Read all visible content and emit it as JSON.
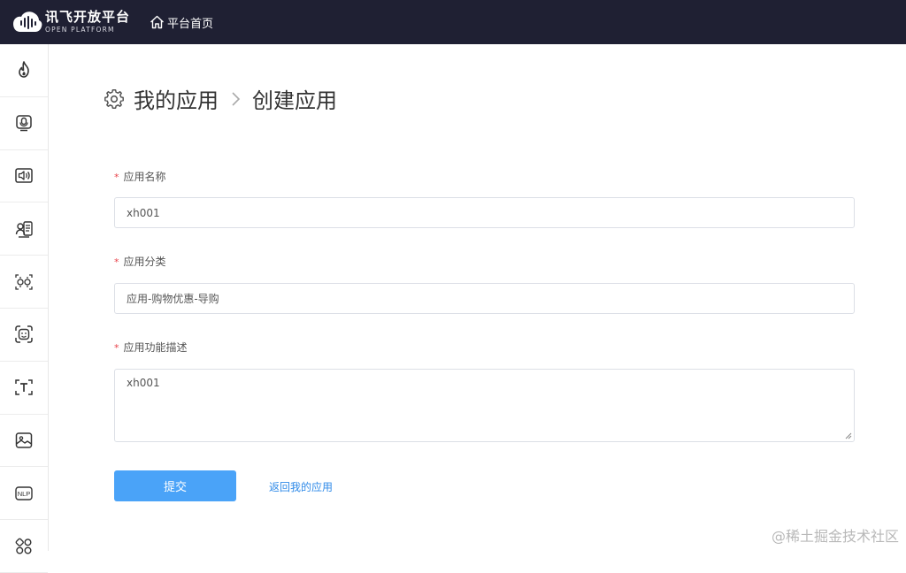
{
  "header": {
    "logo_cn": "讯飞开放平台",
    "logo_en": "OPEN PLATFORM",
    "home_label": "平台首页"
  },
  "sidebar": {
    "items": [
      {
        "icon": "flame-icon"
      },
      {
        "icon": "microphone-icon"
      },
      {
        "icon": "speaker-icon"
      },
      {
        "icon": "voice-text-icon"
      },
      {
        "icon": "voiceprint-icon"
      },
      {
        "icon": "face-scan-icon"
      },
      {
        "icon": "text-recognition-icon"
      },
      {
        "icon": "image-icon"
      },
      {
        "icon": "nlp-icon",
        "text": "NLP"
      },
      {
        "icon": "grid-apps-icon"
      }
    ]
  },
  "breadcrumb": {
    "parent": "我的应用",
    "separator": ">",
    "current": "创建应用"
  },
  "form": {
    "name": {
      "label": "应用名称",
      "required_mark": "*",
      "value": "xh001"
    },
    "category": {
      "label": "应用分类",
      "required_mark": "*",
      "value": "应用-购物优惠-导购"
    },
    "description": {
      "label": "应用功能描述",
      "required_mark": "*",
      "value": "xh001"
    },
    "submit_label": "提交",
    "back_label": "返回我的应用"
  },
  "watermark": "@稀土掘金技术社区",
  "colors": {
    "topbar": "#1f2033",
    "primary_button": "#4aa3f8",
    "link": "#2f8ae8",
    "required": "#e8424a"
  }
}
